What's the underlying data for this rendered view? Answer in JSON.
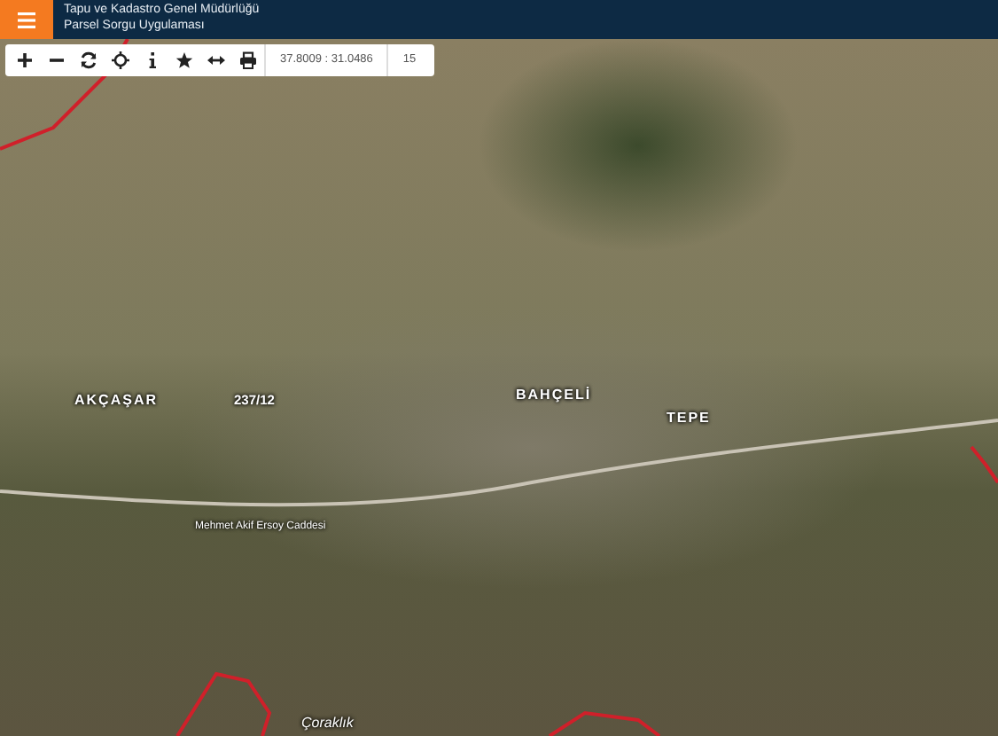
{
  "header": {
    "title": "Tapu ve Kadastro Genel Müdürlüğü",
    "subtitle": "Parsel Sorgu Uygulaması"
  },
  "toolbar": {
    "coordinates": "37.8009 : 31.0486",
    "zoom": "15"
  },
  "map": {
    "labels": [
      {
        "text": "AKÇAŞAR",
        "kind": "place"
      },
      {
        "text": "237/12",
        "kind": "parcel"
      },
      {
        "text": "BAHÇELİ",
        "kind": "place"
      },
      {
        "text": "TEPE",
        "kind": "place"
      },
      {
        "text": "Mehmet Akif Ersoy Caddesi",
        "kind": "street"
      },
      {
        "text": "Çoraklık",
        "kind": "locality"
      }
    ]
  }
}
